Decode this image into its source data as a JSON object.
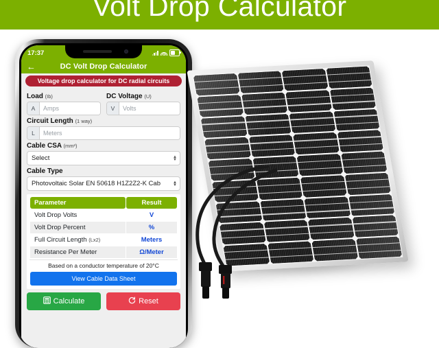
{
  "page": {
    "title": "Volt Drop Calculator",
    "accent_green": "#7CB000",
    "banner_red": "#AF2133",
    "result_blue": "#1348d6"
  },
  "phone": {
    "status_bar": {
      "time": "17:37",
      "icons": [
        "signal-bars-icon",
        "wifi-icon",
        "battery-icon"
      ]
    },
    "app_bar": {
      "back_icon": "arrow-left-icon",
      "title": "DC Volt Drop Calculator"
    },
    "notice": "Voltage drop calculator for DC radial circuits",
    "form": {
      "load": {
        "label": "Load",
        "unit": "(Ib)",
        "prefix": "A",
        "placeholder": "Amps",
        "value": ""
      },
      "voltage": {
        "label": "DC Voltage",
        "unit": "(U)",
        "prefix": "V",
        "placeholder": "Volts",
        "value": ""
      },
      "length": {
        "label": "Circuit Length",
        "unit": "(1 way)",
        "prefix": "L",
        "placeholder": "Meters",
        "value": ""
      },
      "csa": {
        "label": "Cable CSA",
        "unit": "(mm²)",
        "selected": "Select"
      },
      "cable_type": {
        "label": "Cable Type",
        "selected": "Photovoltaic Solar EN 50618 H1Z2Z2-K Cab"
      }
    },
    "results": {
      "headers": [
        "Parameter",
        "Result"
      ],
      "rows": [
        {
          "parameter": "Volt Drop Volts",
          "sub": "",
          "result": "V"
        },
        {
          "parameter": "Volt Drop Percent",
          "sub": "",
          "result": "%"
        },
        {
          "parameter": "Full Circuit Length",
          "sub": "(Lx2)",
          "result": "Meters"
        },
        {
          "parameter": "Resistance Per Meter",
          "sub": "",
          "result": "Ω/Meter"
        }
      ],
      "note": "Based on a conductor temperature of 20°C",
      "datasheet_button": "View Cable Data Sheet"
    },
    "actions": {
      "calculate": {
        "label": "Calculate",
        "icon": "calculator-icon"
      },
      "reset": {
        "label": "Reset",
        "icon": "refresh-icon"
      }
    }
  },
  "illustration": {
    "name": "solar-panel-photo",
    "cell_columns": 4,
    "cell_rows": 9,
    "connectors": 2
  }
}
